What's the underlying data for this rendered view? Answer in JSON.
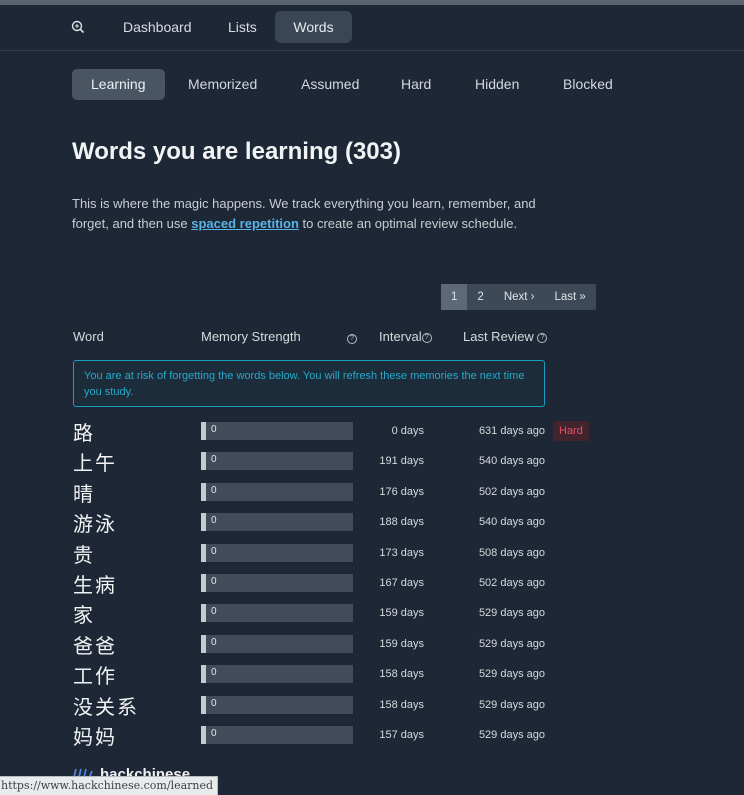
{
  "nav": {
    "tabs": [
      {
        "label": "Dashboard"
      },
      {
        "label": "Lists"
      },
      {
        "label": "Words"
      }
    ]
  },
  "subtabs": [
    {
      "label": "Learning"
    },
    {
      "label": "Memorized"
    },
    {
      "label": "Assumed"
    },
    {
      "label": "Hard"
    },
    {
      "label": "Hidden"
    },
    {
      "label": "Blocked"
    }
  ],
  "page": {
    "title": "Words you are learning (303)",
    "intro_before": "This is where the magic happens. We track everything you learn, remember, and forget, and then use ",
    "intro_link": "spaced repetition",
    "intro_after": " to create an optimal review schedule."
  },
  "pager": {
    "current": "1",
    "page2": "2",
    "next": "Next ›",
    "last": "Last »"
  },
  "table": {
    "headers": {
      "word": "Word",
      "memory": "Memory Strength",
      "interval": "Interval",
      "last_review": "Last Review"
    },
    "alert": "You are at risk of forgetting the words below. You will refresh these memories the next time you study.",
    "rows": [
      {
        "word": "路",
        "strength": "0",
        "interval": "0 days",
        "last_review": "631 days ago",
        "badge": "Hard"
      },
      {
        "word": "上午",
        "strength": "0",
        "interval": "191 days",
        "last_review": "540 days ago"
      },
      {
        "word": "晴",
        "strength": "0",
        "interval": "176 days",
        "last_review": "502 days ago"
      },
      {
        "word": "游泳",
        "strength": "0",
        "interval": "188 days",
        "last_review": "540 days ago"
      },
      {
        "word": "贵",
        "strength": "0",
        "interval": "173 days",
        "last_review": "508 days ago"
      },
      {
        "word": "生病",
        "strength": "0",
        "interval": "167 days",
        "last_review": "502 days ago"
      },
      {
        "word": "家",
        "strength": "0",
        "interval": "159 days",
        "last_review": "529 days ago"
      },
      {
        "word": "爸爸",
        "strength": "0",
        "interval": "159 days",
        "last_review": "529 days ago"
      },
      {
        "word": "工作",
        "strength": "0",
        "interval": "158 days",
        "last_review": "529 days ago"
      },
      {
        "word": "没关系",
        "strength": "0",
        "interval": "158 days",
        "last_review": "529 days ago"
      },
      {
        "word": "妈妈",
        "strength": "0",
        "interval": "157 days",
        "last_review": "529 days ago"
      }
    ]
  },
  "footer": {
    "logo_text": "hackchinese"
  },
  "statusbar": {
    "url": "https://www.hackchinese.com/learned"
  },
  "colors": {
    "background": "#1e2735",
    "accent_link": "#5ab4e8",
    "alert": "#27a9c9",
    "hard_badge": "#e05366"
  }
}
